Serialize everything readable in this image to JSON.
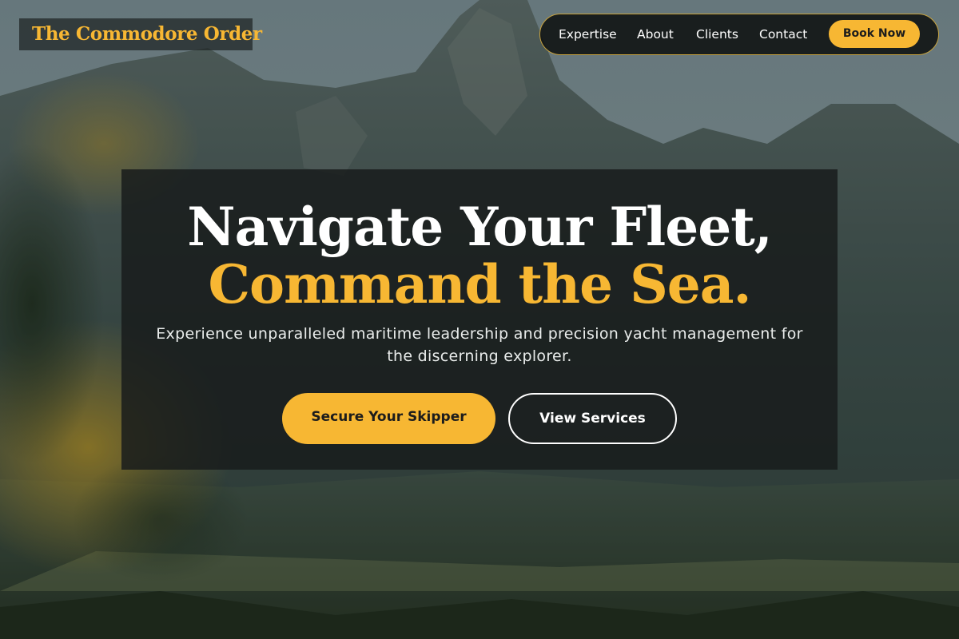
{
  "brand": {
    "name": "The Commodore Order"
  },
  "nav": {
    "links": [
      {
        "label": "Expertise"
      },
      {
        "label": "About"
      },
      {
        "label": "Clients"
      },
      {
        "label": "Contact"
      }
    ],
    "cta_label": "Book Now"
  },
  "hero": {
    "headline_line1": "Navigate Your Fleet,",
    "headline_line2": "Command the Sea.",
    "subtitle_line1": "Experience unparalleled maritime leadership and precision yacht management for",
    "subtitle_line2": "the discerning explorer.",
    "primary_button": "Secure Your Skipper",
    "secondary_button": "View Services"
  },
  "colors": {
    "accent": "#f7b733",
    "nav_background": "#111414",
    "card_background": "#181c1c",
    "text_light": "#ffffff"
  },
  "background": {
    "scene": "mountain-landscape-image"
  }
}
